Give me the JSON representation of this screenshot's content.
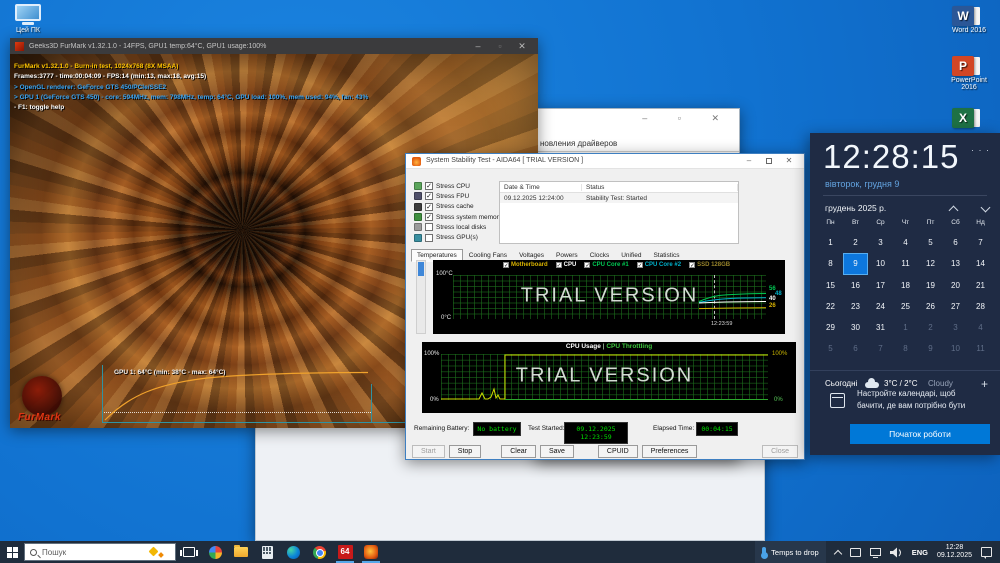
{
  "desktop": {
    "this_pc": "Цей ПК",
    "word_label": "Word 2016",
    "word_letter": "W",
    "ppt_line1": "PowerPoint",
    "ppt_line2": "2016",
    "ppt_letter": "P",
    "excel_letter": "X"
  },
  "furmark": {
    "window_title": "Geeks3D FurMark v1.32.1.0 - 14FPS, GPU1 temp:64°C, GPU1 usage:100%",
    "overlay_lines": [
      {
        "text": "FurMark v1.32.1.0 - Burn-in test, 1024x768 (8X MSAA)",
        "color": "#ffc400"
      },
      {
        "text": "Frames:3777 - time:00:04:09 - FPS:14 (min:13, max:18, avg:15)",
        "color": "#ffffff"
      },
      {
        "text": "> OpenGL renderer: GeForce GTS 450/PCIe/SSE2",
        "color": "#37a5f5"
      },
      {
        "text": "> GPU 1 (GeForce GTS 450) - core: 594MHz, mem: 798MHz, temp: 64°C, GPU load: 100%, mem used: 94%, fan: 43%",
        "color": "#37a5f5"
      },
      {
        "text": "- F1: toggle help",
        "color": "#ffffff"
      }
    ],
    "gpu_graph_label": "GPU 1: 64°C (min: 38°C - max: 64°C)",
    "logo_text": "FurMark",
    "ctrl_min": "–",
    "ctrl_max": "▫",
    "ctrl_close": "✕"
  },
  "driver_window": {
    "visible_text": "новления драйверов",
    "ctrls": "–  ▫  ✕"
  },
  "aida64": {
    "window_title": "System Stability Test - AIDA64 [ TRIAL VERSION ]",
    "ctrl_min": "–",
    "ctrl_close": "✕",
    "stress_options": [
      {
        "label": "Stress CPU",
        "checked": true,
        "icon_color": "#5aa45a"
      },
      {
        "label": "Stress FPU",
        "checked": true,
        "icon_color": "#50506a"
      },
      {
        "label": "Stress cache",
        "checked": true,
        "icon_color": "#3c3c3c"
      },
      {
        "label": "Stress system memory",
        "checked": true,
        "icon_color": "#3f8f3f"
      },
      {
        "label": "Stress local disks",
        "checked": false,
        "icon_color": "#9a9a9a"
      },
      {
        "label": "Stress GPU(s)",
        "checked": false,
        "icon_color": "#3a8fa0"
      }
    ],
    "log": {
      "columns": [
        "Date & Time",
        "Status"
      ],
      "rows": [
        [
          "09.12.2025 12:24:00",
          "Stability Test: Started"
        ]
      ]
    },
    "tabs": [
      "Temperatures",
      "Cooling Fans",
      "Voltages",
      "Powers",
      "Clocks",
      "Unified",
      "Statistics"
    ],
    "active_tab": "Temperatures",
    "temp_graph": {
      "legend": [
        {
          "label": "Motherboard",
          "color": "#d8b200"
        },
        {
          "label": "CPU",
          "color": "#ffffff"
        },
        {
          "label": "CPU Core #1",
          "color": "#00c853"
        },
        {
          "label": "CPU Core #2",
          "color": "#00b2cc"
        },
        {
          "label": "SSD 128GB",
          "color": "#97832a"
        }
      ],
      "y_max": "100°C",
      "y_min": "0°C",
      "watermark": "TRIAL VERSION",
      "start_time": "12:23:59",
      "current_values": [
        {
          "value": "56",
          "color": "#00c853"
        },
        {
          "value": "48",
          "color": "#00b2cc"
        },
        {
          "value": "40",
          "color": "#ffffff"
        },
        {
          "value": "26",
          "color": "#d8b200"
        }
      ]
    },
    "usage_graph": {
      "title_left": "CPU Usage",
      "title_sep": " | ",
      "title_right": "CPU Throttling",
      "y_max_left": "100%",
      "y_min_left": "0%",
      "y_max_right": "100%",
      "y_min_right": "0%",
      "watermark": "TRIAL VERSION"
    },
    "status_row": {
      "battery_label": "Remaining Battery:",
      "battery_value": "No battery",
      "started_label": "Test Started:",
      "started_value": "09.12.2025 12:23:59",
      "elapsed_label": "Elapsed Time:",
      "elapsed_value": "00:04:15"
    },
    "buttons": [
      {
        "label": "Start",
        "enabled": false
      },
      {
        "label": "Stop",
        "enabled": true
      },
      {
        "label": "Clear",
        "enabled": true
      },
      {
        "label": "Save",
        "enabled": true
      },
      {
        "label": "CPUID",
        "enabled": true
      },
      {
        "label": "Preferences",
        "enabled": true
      },
      {
        "label": "Close",
        "enabled": false
      }
    ]
  },
  "clock_panel": {
    "time": "12:28:15",
    "more": "· · ·",
    "date_line": "вівторок, грудня 9",
    "month_header": "грудень 2025 р.",
    "weekdays": [
      "Пн",
      "Вт",
      "Ср",
      "Чт",
      "Пт",
      "Сб",
      "Нд"
    ],
    "days": [
      {
        "t": "1"
      },
      {
        "t": "2"
      },
      {
        "t": "3"
      },
      {
        "t": "4"
      },
      {
        "t": "5"
      },
      {
        "t": "6"
      },
      {
        "t": "7"
      },
      {
        "t": "8"
      },
      {
        "t": "9",
        "sel": true
      },
      {
        "t": "10"
      },
      {
        "t": "11"
      },
      {
        "t": "12"
      },
      {
        "t": "13"
      },
      {
        "t": "14"
      },
      {
        "t": "15"
      },
      {
        "t": "16"
      },
      {
        "t": "17"
      },
      {
        "t": "18"
      },
      {
        "t": "19"
      },
      {
        "t": "20"
      },
      {
        "t": "21"
      },
      {
        "t": "22"
      },
      {
        "t": "23"
      },
      {
        "t": "24"
      },
      {
        "t": "25"
      },
      {
        "t": "26"
      },
      {
        "t": "27"
      },
      {
        "t": "28"
      },
      {
        "t": "29"
      },
      {
        "t": "30"
      },
      {
        "t": "31"
      },
      {
        "t": "1",
        "dim": true
      },
      {
        "t": "2",
        "dim": true
      },
      {
        "t": "3",
        "dim": true
      },
      {
        "t": "4",
        "dim": true
      },
      {
        "t": "5",
        "dim": true
      },
      {
        "t": "6",
        "dim": true
      },
      {
        "t": "7",
        "dim": true
      },
      {
        "t": "8",
        "dim": true
      },
      {
        "t": "9",
        "dim": true
      },
      {
        "t": "10",
        "dim": true
      },
      {
        "t": "11",
        "dim": true
      }
    ],
    "today_label": "Сьогодні",
    "weather_temp": "3°C / 2°C",
    "weather_cond": "Cloudy",
    "plus": "+",
    "hint_line1": "Настройте календарі, щоб",
    "hint_line2": "бачити, де вам потрібно бути",
    "cta": "Початок роботи"
  },
  "taskbar": {
    "search_placeholder": "Пошук",
    "aida_badge": "64",
    "tray_weather": "Temps to drop",
    "language": "ENG",
    "clock_time": "12:28",
    "clock_date": "09.12.2025"
  }
}
